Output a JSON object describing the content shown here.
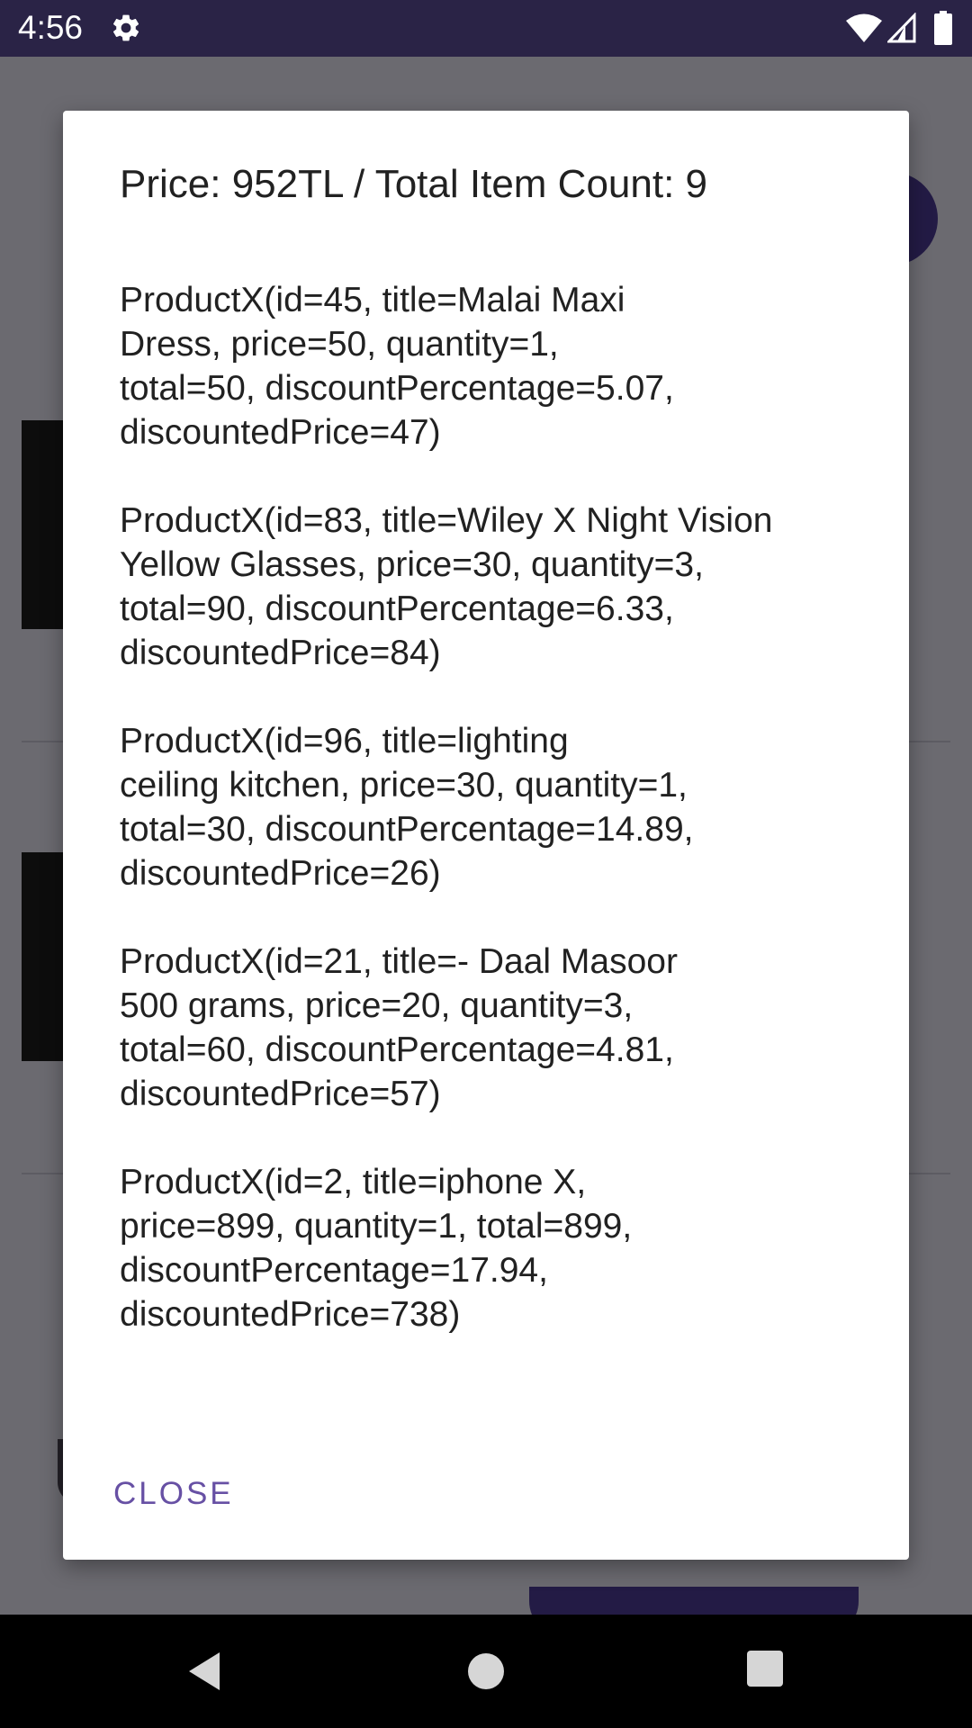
{
  "status_bar": {
    "time": "4:56",
    "icons": [
      "gear-icon",
      "wifi-icon",
      "signal-icon",
      "battery-icon"
    ]
  },
  "dialog": {
    "title": "Price: 952TL / Total Item Count: 9",
    "products": [
      "ProductX(id=45, title=Malai Maxi\nDress, price=50, quantity=1,\ntotal=50, discountPercentage=5.07,\ndiscountedPrice=47)",
      "ProductX(id=83, title=Wiley X Night Vision\nYellow Glasses, price=30, quantity=3,\ntotal=90, discountPercentage=6.33,\ndiscountedPrice=84)",
      "ProductX(id=96, title=lighting\nceiling kitchen, price=30, quantity=1,\ntotal=30, discountPercentage=14.89,\ndiscountedPrice=26)",
      "ProductX(id=21, title=- Daal Masoor\n500 grams, price=20, quantity=3,\ntotal=60, discountPercentage=4.81,\ndiscountedPrice=57)",
      "ProductX(id=2, title=iphone X,\nprice=899, quantity=1, total=899,\ndiscountPercentage=17.94,\ndiscountedPrice=738)"
    ],
    "close_label": "CLOSE"
  },
  "colors": {
    "status_bar": "#2a2346",
    "accent": "#6750a4",
    "scrim": "#6b6a70"
  },
  "nav_bar": {
    "icons": [
      "back-icon",
      "home-icon",
      "recents-icon"
    ]
  }
}
